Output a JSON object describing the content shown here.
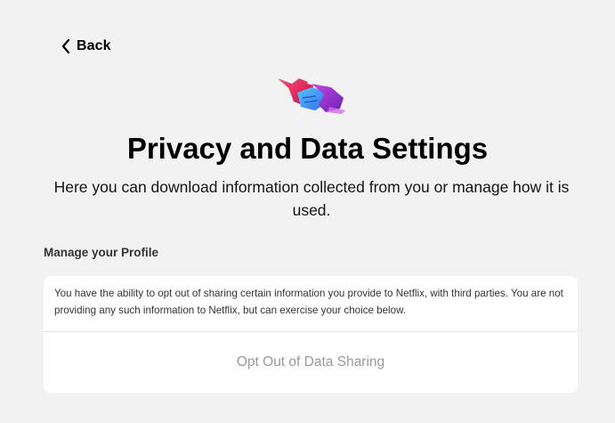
{
  "header": {
    "back_label": "Back"
  },
  "illustration": {
    "icon": "handshake-icon",
    "colors": [
      "#e0245e",
      "#8a2be2",
      "#3fa9f5",
      "#c23fd6"
    ]
  },
  "page": {
    "title": "Privacy and Data Settings",
    "subtitle": "Here you can download information collected from you or manage how it is used."
  },
  "profile_section": {
    "label": "Manage your Profile",
    "description": "You have the ability to opt out of sharing certain information you provide to Netflix, with third parties. You are not providing any such information to Netflix, but can exercise your choice below.",
    "opt_out_label": "Opt Out of Data Sharing"
  }
}
